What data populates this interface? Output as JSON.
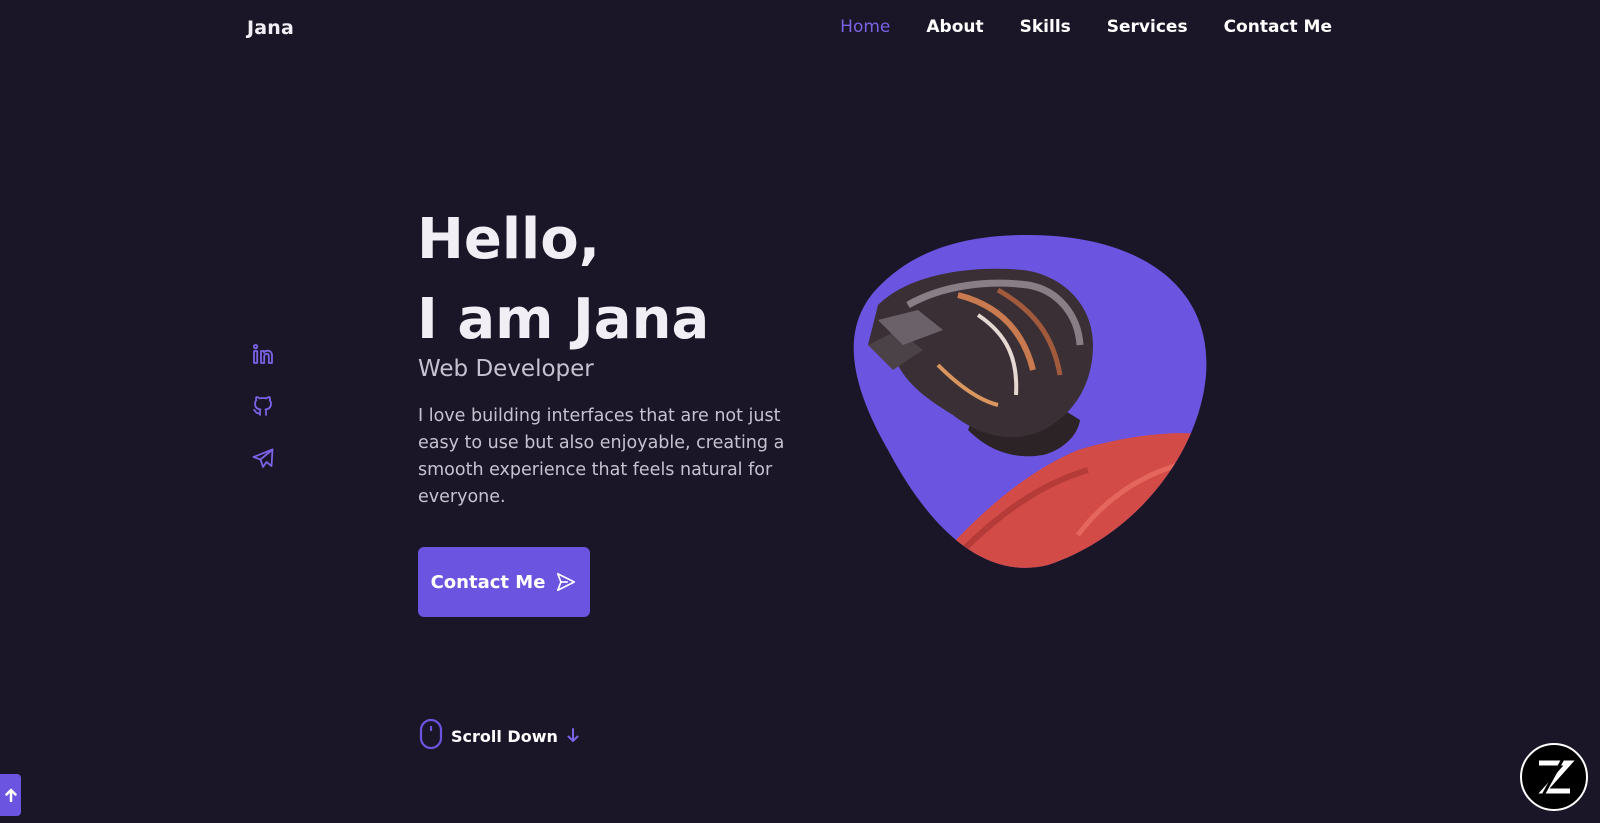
{
  "header": {
    "logo": "Jana",
    "nav": [
      {
        "label": "Home",
        "active": true
      },
      {
        "label": "About",
        "active": false
      },
      {
        "label": "Skills",
        "active": false
      },
      {
        "label": "Services",
        "active": false
      },
      {
        "label": "Contact Me",
        "active": false
      }
    ]
  },
  "social": [
    {
      "icon": "linkedin-icon"
    },
    {
      "icon": "github-icon"
    },
    {
      "icon": "telegram-icon"
    }
  ],
  "hero": {
    "greeting": "Hello,",
    "name_line": "I am Jana",
    "subtitle": "Web Developer",
    "description": "I love building interfaces that are not just easy to use but also enjoyable, creating a smooth experience that feels natural for everyone.",
    "cta_label": "Contact Me"
  },
  "scroll": {
    "label": "Scroll Down"
  },
  "colors": {
    "background": "#1b1627",
    "accent": "#6b55e0",
    "accent_light": "#7b62e6",
    "text": "#f1eff5",
    "muted": "#c6c2d1"
  }
}
